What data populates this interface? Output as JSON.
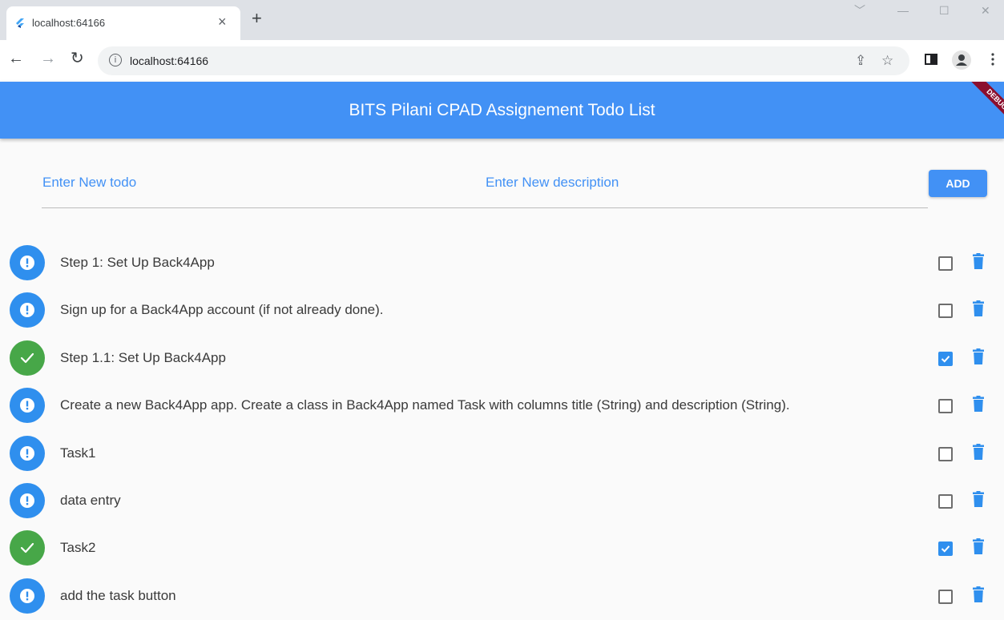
{
  "browser": {
    "tab_title": "localhost:64166",
    "tab_close": "×",
    "new_tab": "+",
    "url": "localhost:64166",
    "window_controls": [
      "﹀",
      "—",
      "☐",
      "✕"
    ]
  },
  "appbar": {
    "title": "BITS Pilani CPAD Assignement Todo List",
    "color": "#4291f5",
    "debug_banner": "DEBUG"
  },
  "form": {
    "todo_placeholder": "Enter New todo",
    "description_placeholder": "Enter New description",
    "add_label": "ADD"
  },
  "todos": [
    {
      "title": "Step 1: Set Up Back4App",
      "done": false,
      "status_icon": "exclamation-icon"
    },
    {
      "title": "Sign up for a Back4App account (if not already done).",
      "done": false,
      "status_icon": "exclamation-icon"
    },
    {
      "title": "Step 1.1: Set Up Back4App",
      "done": true,
      "status_icon": "check-icon"
    },
    {
      "title": "Create a new Back4App app. Create a class in Back4App named Task with columns title (String) and description (String).",
      "done": false,
      "status_icon": "exclamation-icon"
    },
    {
      "title": "Task1",
      "done": false,
      "status_icon": "exclamation-icon"
    },
    {
      "title": "data entry",
      "done": false,
      "status_icon": "exclamation-icon"
    },
    {
      "title": "Task2",
      "done": true,
      "status_icon": "check-icon"
    },
    {
      "title": "add the task button",
      "done": false,
      "status_icon": "exclamation-icon"
    }
  ],
  "colors": {
    "pending": "#2f8fee",
    "done": "#47a748",
    "delete": "#2f8fee"
  }
}
